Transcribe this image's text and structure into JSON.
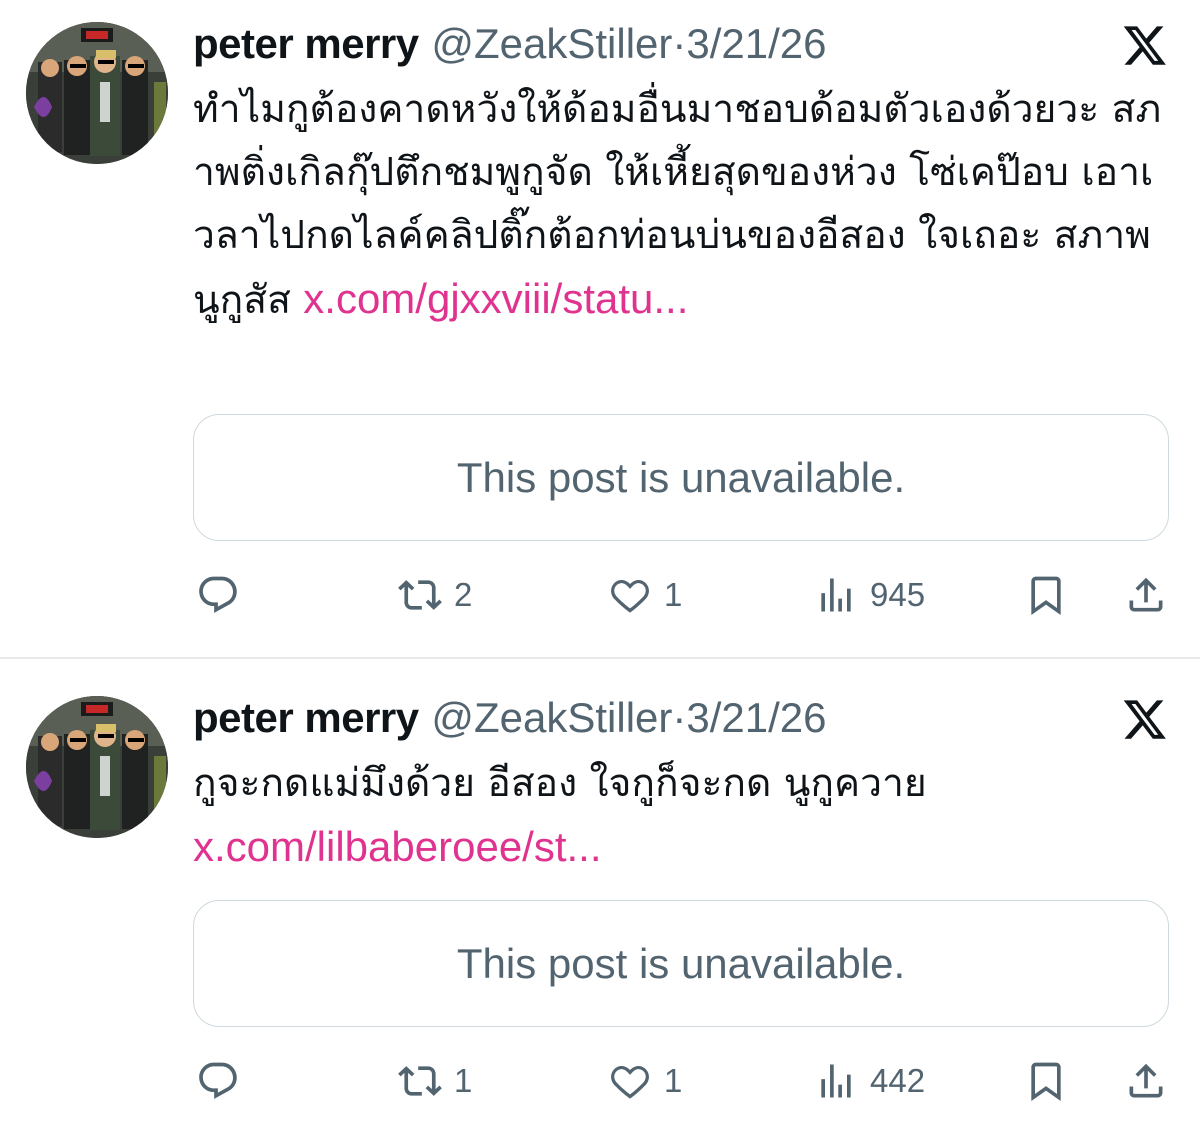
{
  "tweets": [
    {
      "author_name": "peter merry",
      "handle": "@ZeakStiller",
      "separator": "·",
      "date": "3/21/26",
      "text": "ทำไมกูต้องคาดหวังให้ด้อมอื่นมาชอบด้อมตัวเองด้วยวะ สภาพติ่งเกิลกุ๊ปตึกชมพูกูจัด ให้เหี้ยสุดของห่วง โซ่เคป๊อบ เอาเวลาไปกดไลค์คลิปติ๊กต้อกท่อนบ่นของอีสอง ใจเถอะ สภาพนูกูสัส ",
      "link": "x.com/gjxxviii/statu...",
      "quote_card": "This post is unavailable.",
      "reposts": "2",
      "likes": "1",
      "views": "945"
    },
    {
      "author_name": "peter merry",
      "handle": "@ZeakStiller",
      "separator": "·",
      "date": "3/21/26",
      "text": "กูจะกดแม่มึงด้วย อีสอง ใจกูก็จะกด นูกูควาย\n",
      "link": "x.com/lilbaberoee/st...",
      "quote_card": "This post is unavailable.",
      "reposts": "1",
      "likes": "1",
      "views": "442"
    }
  ],
  "icons": {
    "reply": "reply-icon",
    "repost": "repost-icon",
    "like": "heart-icon",
    "views": "views-icon",
    "bookmark": "bookmark-icon",
    "share": "share-icon",
    "platform": "x-logo-icon"
  },
  "colors": {
    "link": "#e0338f",
    "secondary_text": "#536471",
    "border": "#cfd9de"
  }
}
